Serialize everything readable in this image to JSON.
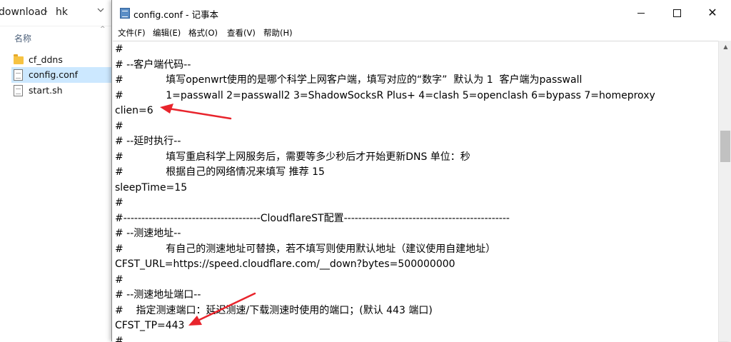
{
  "explorer": {
    "breadcrumb": {
      "parent": "download",
      "separator": "›",
      "current": "hk",
      "dropdown_icon": "chevron-down-icon"
    },
    "column_header": "名称",
    "sort_indicator": "^",
    "files": [
      {
        "name": "cf_ddns",
        "icon": "folder-icon",
        "selected": false
      },
      {
        "name": "config.conf",
        "icon": "document-icon",
        "selected": true
      },
      {
        "name": "start.sh",
        "icon": "document-icon",
        "selected": false
      }
    ]
  },
  "notepad": {
    "title": "config.conf - 记事本",
    "window_buttons": {
      "minimize": "minimize-icon",
      "maximize": "maximize-icon",
      "close": "✕"
    },
    "menu": [
      "文件(F)",
      "编辑(E)",
      "格式(O)",
      "查看(V)",
      "帮助(H)"
    ],
    "lines": [
      "#",
      "# --客户端代码--",
      "#\t\t填写openwrt使用的是哪个科学上网客户端，填写对应的“数字”  默认为 1  客户端为passwall",
      "#\t\t1=passwall 2=passwall2 3=ShadowSocksR Plus+ 4=clash 5=openclash 6=bypass 7=homeproxy",
      "clien=6",
      "#",
      "# --延时执行--",
      "#\t\t填写重启科学上网服务后，需要等多少秒后才开始更新DNS 单位：秒",
      "#\t\t根据自己的网络情况来填写 推荐 15",
      "sleepTime=15",
      "#",
      "#--------------------------------------CloudflareST配置----------------------------------------------",
      "# --测速地址--",
      "#\t\t有自己的测速地址可替换，若不填写则使用默认地址（建议使用自建地址）",
      "CFST_URL=https://speed.cloudflare.com/__down?bytes=500000000",
      "#",
      "# --测速地址端口--",
      "#    指定测速端口：延迟测速/下载测速时使用的端口；(默认 443 端口)",
      "CFST_TP=443",
      "#"
    ],
    "annotation_color": "#e8242c"
  }
}
